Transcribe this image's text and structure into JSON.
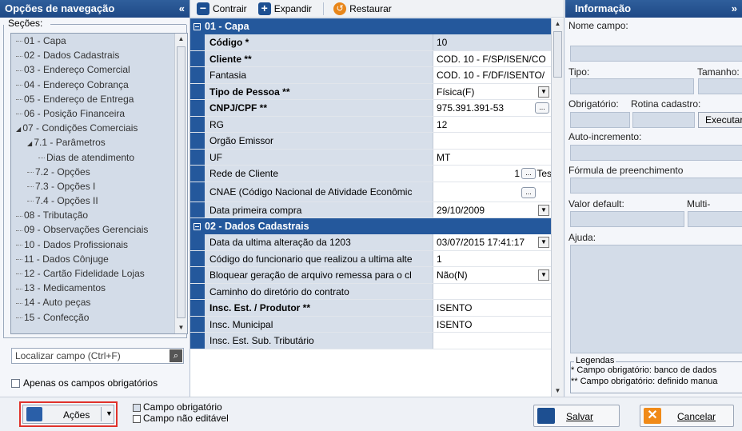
{
  "left_panel": {
    "title": "Opções de navegação",
    "collapse_glyph": "«",
    "sections_label": "Seções:",
    "tree": [
      {
        "label": "01 - Capa",
        "indent": 0
      },
      {
        "label": "02 - Dados Cadastrais",
        "indent": 0
      },
      {
        "label": "03 - Endereço Comercial",
        "indent": 0
      },
      {
        "label": "04 - Endereço Cobrança",
        "indent": 0
      },
      {
        "label": "05 - Endereço de Entrega",
        "indent": 0
      },
      {
        "label": "06 - Posição Financeira",
        "indent": 0
      },
      {
        "label": "07 - Condições Comerciais",
        "indent": 0,
        "expanded": true
      },
      {
        "label": "7.1 - Parâmetros",
        "indent": 1,
        "expanded": true
      },
      {
        "label": "Dias de atendimento",
        "indent": 2
      },
      {
        "label": "7.2 - Opções",
        "indent": 1
      },
      {
        "label": "7.3 - Opções I",
        "indent": 1
      },
      {
        "label": "7.4 - Opções II",
        "indent": 1
      },
      {
        "label": "08 - Tributação",
        "indent": 0
      },
      {
        "label": "09 - Observações Gerenciais",
        "indent": 0
      },
      {
        "label": "10 - Dados Profissionais",
        "indent": 0
      },
      {
        "label": "11 - Dados Cônjuge",
        "indent": 0
      },
      {
        "label": "12 - Cartão Fidelidade Lojas",
        "indent": 0
      },
      {
        "label": "13 - Medicamentos",
        "indent": 0
      },
      {
        "label": "14 - Auto peças",
        "indent": 0
      },
      {
        "label": "15 - Confecção",
        "indent": 0
      }
    ],
    "search_placeholder": "Localizar campo (Ctrl+F)",
    "only_required": "Apenas os campos obrigatórios"
  },
  "toolbar": {
    "collapse": "Contrair",
    "expand": "Expandir",
    "restore": "Restaurar"
  },
  "grid": {
    "categories": [
      {
        "title": "01 - Capa",
        "rows": [
          {
            "name": "Código *",
            "value": "10",
            "bold": true,
            "shade": true
          },
          {
            "name": "Cliente **",
            "value": "COD. 10 - F/SP/ISEN/CO",
            "bold": true
          },
          {
            "name": "Fantasia",
            "value": "COD. 10 - F/DF/ISENTO/",
            "bold": false
          },
          {
            "name": "Tipo de Pessoa **",
            "value": "Física(F)",
            "bold": true,
            "control": "dropdown"
          },
          {
            "name": "CNPJ/CPF **",
            "value": "975.391.391-53",
            "bold": true,
            "control": "ellipsis"
          },
          {
            "name": "RG",
            "value": "12",
            "bold": false
          },
          {
            "name": "Orgão Emissor",
            "value": "",
            "bold": false
          },
          {
            "name": "UF",
            "value": "MT",
            "bold": false
          },
          {
            "name": "Rede de Cliente",
            "value": "1",
            "suffix": "Tes",
            "bold": false,
            "control": "ellipsis-right"
          },
          {
            "name": "CNAE (Código Nacional de Atividade Econômic",
            "value": "",
            "bold": false,
            "control": "ellipsis-right",
            "tall": true
          },
          {
            "name": "Data primeira compra",
            "value": "29/10/2009",
            "bold": false,
            "control": "dropdown"
          }
        ]
      },
      {
        "title": "02 - Dados Cadastrais",
        "rows": [
          {
            "name": "Data da ultima alteração da 1203",
            "value": "03/07/2015 17:41:17",
            "bold": false,
            "control": "dropdown"
          },
          {
            "name": "Código do funcionario que realizou a ultima alte",
            "value": "1",
            "bold": false
          },
          {
            "name": "Bloquear geração de arquivo remessa para o cl",
            "value": "Não(N)",
            "bold": false,
            "control": "dropdown"
          },
          {
            "name": "Caminho do diretório do contrato",
            "value": "",
            "bold": false
          },
          {
            "name": "Insc. Est. / Produtor **",
            "value": "ISENTO",
            "bold": true
          },
          {
            "name": "Insc. Municipal",
            "value": "ISENTO",
            "bold": false
          },
          {
            "name": "Insc. Est. Sub. Tributário",
            "value": "",
            "bold": false
          }
        ]
      }
    ]
  },
  "info_panel": {
    "title": "Informação",
    "expand_glyph": "»",
    "field_name": "Nome campo:",
    "type": "Tipo:",
    "size": "Tamanho:",
    "required": "Obrigatório:",
    "routine": "Rotina cadastro:",
    "execute": "Executar",
    "auto_increment": "Auto-incremento:",
    "fill_formula": "Fórmula de preenchimento",
    "default_value": "Valor default:",
    "multi_edit": "Multi-Edição:",
    "help": "Ajuda:",
    "legend_title": "Legendas",
    "legend_line1": "* Campo obrigatório: banco de dados",
    "legend_line2": "** Campo obrigatório: definido manua"
  },
  "bottom_bar": {
    "actions": "Ações",
    "legend_required": "Campo obrigatório",
    "legend_not_editable": "Campo não editável",
    "save": "Salvar",
    "cancel": "Cancelar"
  },
  "colors": {
    "header_blue": "#1e4886",
    "category_blue": "#24589c",
    "name_cell": "#d7dfea",
    "field_bg": "#d3dce8",
    "actions_highlight": "#e0322b"
  }
}
